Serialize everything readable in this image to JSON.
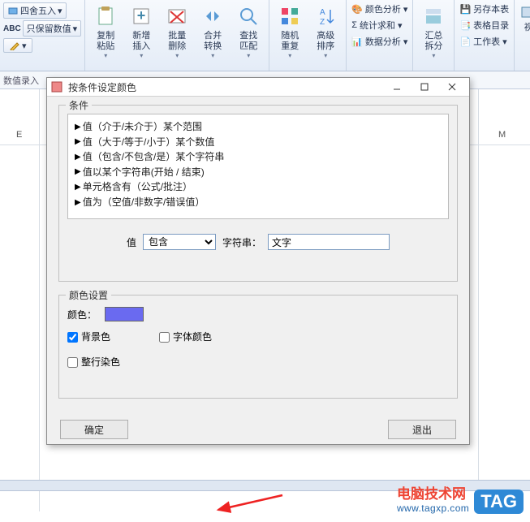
{
  "ribbon": {
    "left": {
      "round": "四舍五入",
      "keep_value": "只保留数值",
      "abc": "ABC"
    },
    "groups": [
      {
        "label": "复制\n粘贴",
        "icon": "clipboard"
      },
      {
        "label": "新增\n插入",
        "icon": "new-sheet"
      },
      {
        "label": "批量\n删除",
        "icon": "delete-batch"
      },
      {
        "label": "合并\n转换",
        "icon": "merge"
      },
      {
        "label": "查找\n匹配",
        "icon": "find"
      }
    ],
    "groups2": [
      {
        "label": "随机\n重复",
        "icon": "random"
      },
      {
        "label": "高级\n排序",
        "icon": "sort"
      }
    ],
    "side": {
      "color_analysis": "颜色分析",
      "stats_sum": "统计求和",
      "data_analysis": "数据分析"
    },
    "side2": {
      "summary": "汇总\n拆分"
    },
    "side3": {
      "save_as_table": "另存本表",
      "form_list": "表格目录",
      "worksheet": "工作表"
    },
    "far_right": "视"
  },
  "formula_bar": "数值录入",
  "columns": {
    "e": "E",
    "m": "M"
  },
  "dialog": {
    "title": "按条件设定颜色",
    "group_condition": "条件",
    "conditions": [
      "值（介于/未介于）某个范围",
      "值（大于/等于/小于）某个数值",
      "值（包含/不包含/是）某个字符串",
      "值以某个字符串(开始 / 结束)",
      "单元格含有（公式/批注）",
      "值为（空值/非数字/错误值）"
    ],
    "value_label": "值",
    "combo_selected": "包含",
    "string_label": "字符串：",
    "string_value": "文字",
    "group_color": "颜色设置",
    "color_label": "颜色：",
    "color_hex": "#6a6af0",
    "cb_bg": "背景色",
    "cb_font": "字体颜色",
    "cb_row": "整行染色",
    "ok": "确定",
    "cancel": "退出"
  },
  "watermark": {
    "line1": "电脑技术网",
    "line2": "www.tagxp.com",
    "tag": "TAG"
  }
}
